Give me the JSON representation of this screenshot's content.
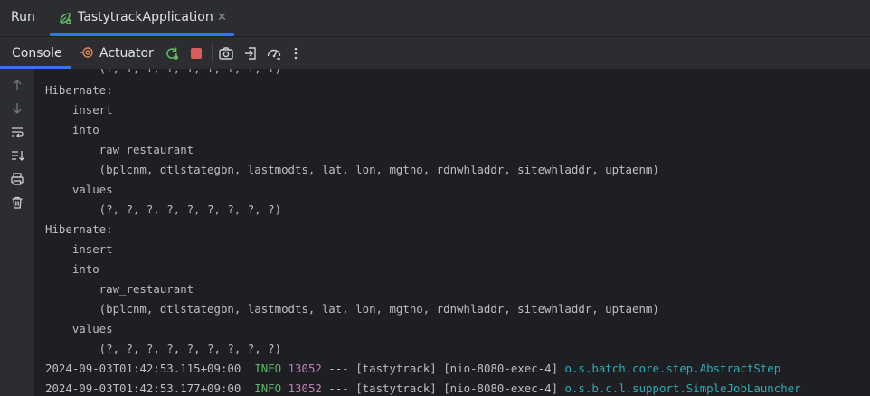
{
  "title_bar": {
    "run_label": "Run",
    "tab": {
      "label": "TastytrackApplication",
      "close_icon": "close-icon",
      "icon": "spring-boot-run-icon"
    }
  },
  "toolbar": {
    "console_label": "Console",
    "actuator_label": "Actuator",
    "buttons": [
      "rerun-icon",
      "stop-icon",
      "screenshot-icon",
      "exit-icon",
      "dashboard-icon",
      "more-vertical-icon"
    ]
  },
  "gutter": {
    "buttons": [
      "arrow-up-icon",
      "arrow-down-icon",
      "soft-wrap-icon",
      "scroll-to-end-icon",
      "print-icon",
      "trash-icon"
    ]
  },
  "colors": {
    "accent": "#3574f0",
    "background": "#1e1f22",
    "panel": "#2b2d30",
    "text": "#bcbec4",
    "info": "#5fb865",
    "pid": "#c77dbb",
    "logger": "#2aacb8",
    "stop": "#db5c5c"
  },
  "console": {
    "lines": [
      "        (?, ?, ?, ?, ?, ?, ?, ?, ?)",
      "Hibernate: ",
      "    insert ",
      "    into",
      "        raw_restaurant",
      "        (bplcnm, dtlstategbn, lastmodts, lat, lon, mgtno, rdnwhladdr, sitewhladdr, uptaenm) ",
      "    values",
      "        (?, ?, ?, ?, ?, ?, ?, ?, ?)",
      "Hibernate: ",
      "    insert ",
      "    into",
      "        raw_restaurant",
      "        (bplcnm, dtlstategbn, lastmodts, lat, lon, mgtno, rdnwhladdr, sitewhladdr, uptaenm) ",
      "    values",
      "        (?, ?, ?, ?, ?, ?, ?, ?, ?)"
    ],
    "log_entries": [
      {
        "timestamp": "2024-09-03T01:42:53.115+09:00",
        "level": "INFO",
        "pid": "13052",
        "sep": "---",
        "app": "[tastytrack]",
        "thread": "[nio-8080-exec-4]",
        "logger": "o.s.batch.core.step.AbstractStep"
      },
      {
        "timestamp": "2024-09-03T01:42:53.177+09:00",
        "level": "INFO",
        "pid": "13052",
        "sep": "---",
        "app": "[tastytrack]",
        "thread": "[nio-8080-exec-4]",
        "logger": "o.s.b.c.l.support.SimpleJobLauncher"
      }
    ]
  }
}
